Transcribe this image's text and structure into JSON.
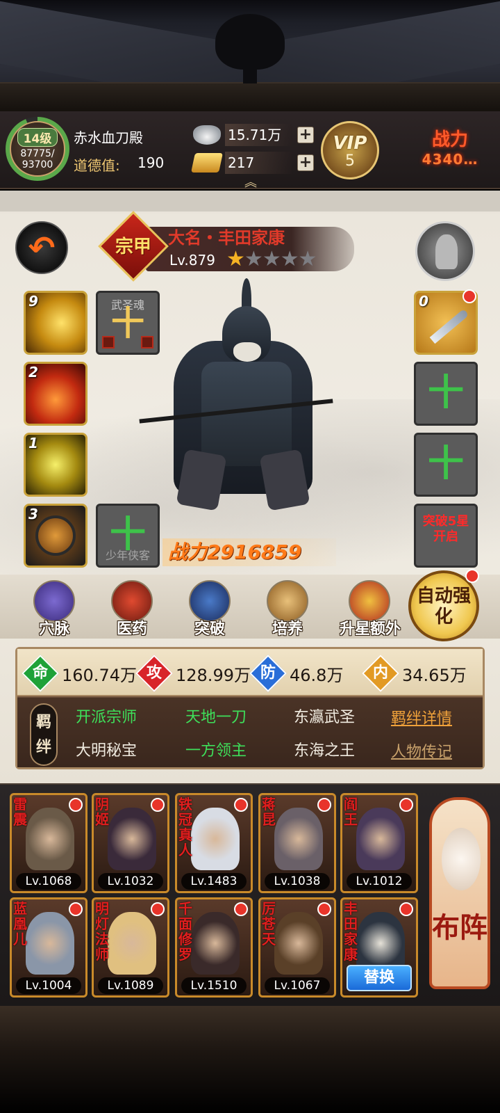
{
  "player": {
    "level_badge": "14级",
    "exp_current": "87775/",
    "exp_max": "93700",
    "exp_progress": 0.937,
    "name": "赤水血刀殿",
    "moral_label": "道德值:",
    "moral_value": "190"
  },
  "currencies": [
    {
      "icon": "silver-ingot-icon",
      "value": "15.71万",
      "plus": "+"
    },
    {
      "icon": "gold-bars-icon",
      "value": "217",
      "plus": "+"
    }
  ],
  "vip": {
    "label": "VIP",
    "level": "5"
  },
  "top_power": {
    "label": "战力",
    "value": "4340…"
  },
  "hero": {
    "rank_seal": "宗甲",
    "name": "大名・丰田家康",
    "level": "Lv.879",
    "stars_filled": 1,
    "stars_total": 5,
    "power": "战力2916859"
  },
  "left_slots": [
    {
      "count": "9",
      "kind": "skill-1"
    },
    {
      "count": "2",
      "kind": "skill-2"
    },
    {
      "count": "1",
      "kind": "skill-3"
    },
    {
      "count": "3",
      "kind": "skill-4"
    }
  ],
  "soul_slot": {
    "caption": "武圣魂",
    "plus": "十"
  },
  "youth_slot": {
    "plus": "十",
    "caption": "少年侠客"
  },
  "right_slots": {
    "weapon_count": "0",
    "empty_plus": "十",
    "locked_text": "突破5星开启"
  },
  "functions": [
    {
      "label": "穴脉",
      "icon": "meridian-icon"
    },
    {
      "label": "医药",
      "icon": "medicine-icon"
    },
    {
      "label": "突破",
      "icon": "breakthrough-icon"
    },
    {
      "label": "培养",
      "icon": "scroll-icon"
    },
    {
      "label": "升星额外",
      "icon": "treasure-icon"
    }
  ],
  "auto_enhance": {
    "label": "自动强化"
  },
  "stats": [
    {
      "icon": "命",
      "value": "160.74万"
    },
    {
      "icon": "攻",
      "value": "128.99万"
    },
    {
      "icon": "防",
      "value": "46.8万"
    },
    {
      "icon": "内",
      "value": "34.65万"
    }
  ],
  "bonds": {
    "tag": "羁绊",
    "items": [
      {
        "label": "开派宗师",
        "active": true
      },
      {
        "label": "天地一刀",
        "active": true
      },
      {
        "label": "东瀛武圣",
        "active": false
      },
      {
        "label": "大明秘宝",
        "active": false
      },
      {
        "label": "一方领主",
        "active": true
      },
      {
        "label": "东海之王",
        "active": false
      }
    ],
    "details_link": "羁绊详情",
    "bio_link": "人物传记"
  },
  "roster": [
    {
      "name": "雷震",
      "level": "Lv.1068",
      "color": "#6a5a48"
    },
    {
      "name": "阴姬",
      "level": "Lv.1032",
      "color": "#3a2a3a"
    },
    {
      "name": "铁冠真人",
      "level": "Lv.1483",
      "color": "#d8dce4"
    },
    {
      "name": "蒋昆",
      "level": "Lv.1038",
      "color": "#6a6068"
    },
    {
      "name": "阎王",
      "level": "Lv.1012",
      "color": "#4a3a5a"
    },
    {
      "name": "蓝凰儿",
      "level": "Lv.1004",
      "color": "#8a96a8"
    },
    {
      "name": "明灯法师",
      "level": "Lv.1089",
      "color": "#e0c080"
    },
    {
      "name": "千面修罗",
      "level": "Lv.1510",
      "color": "#3a2a2a"
    },
    {
      "name": "厉苍天",
      "level": "Lv.1067",
      "color": "#5a4028"
    }
  ],
  "replace_card": {
    "name": "丰田家康",
    "button": "替换"
  },
  "formation": {
    "label": "布阵"
  }
}
